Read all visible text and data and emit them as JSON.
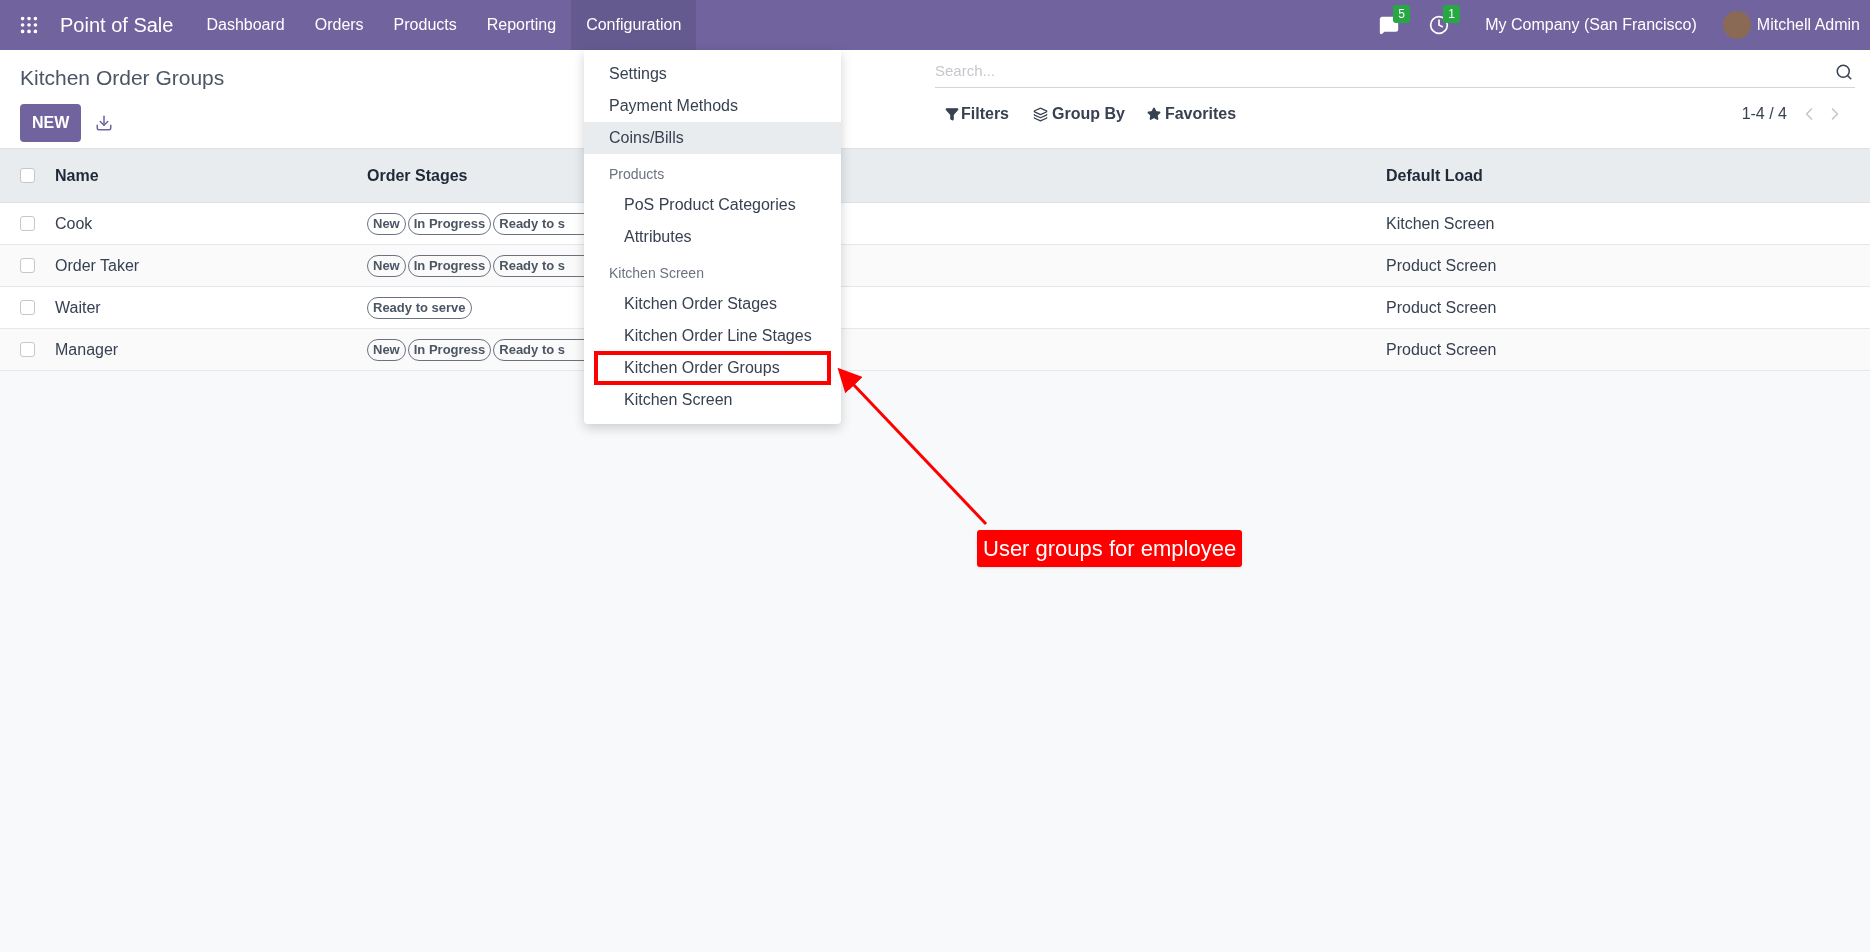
{
  "navbar": {
    "app_title": "Point of Sale",
    "menu": [
      {
        "label": "Dashboard",
        "selected": false
      },
      {
        "label": "Orders",
        "selected": false
      },
      {
        "label": "Products",
        "selected": false
      },
      {
        "label": "Reporting",
        "selected": false
      },
      {
        "label": "Configuration",
        "selected": true
      }
    ],
    "messages_count": "5",
    "activities_count": "1",
    "company": "My Company (San Francisco)",
    "user": "Mitchell Admin"
  },
  "control_panel": {
    "title": "Kitchen Order Groups",
    "new_button": "NEW",
    "search": {
      "placeholder": "Search..."
    },
    "filters": "Filters",
    "group_by": "Group By",
    "favorites": "Favorites",
    "pager": "1-4 / 4"
  },
  "table": {
    "select_all_checked": false,
    "columns": [
      "Name",
      "Order Stages",
      "Default Load"
    ],
    "rows": [
      {
        "name": "Cook",
        "stages": [
          {
            "label": "New",
            "truncated": false
          },
          {
            "label": "In Progress",
            "truncated": false
          },
          {
            "label": "Ready to s",
            "truncated": true
          }
        ],
        "default_load": "Kitchen Screen",
        "checked": false
      },
      {
        "name": "Order Taker",
        "stages": [
          {
            "label": "New",
            "truncated": false
          },
          {
            "label": "In Progress",
            "truncated": false
          },
          {
            "label": "Ready to s",
            "truncated": true
          }
        ],
        "default_load": "Product Screen",
        "checked": false
      },
      {
        "name": "Waiter",
        "stages": [
          {
            "label": "Ready to serve",
            "truncated": false
          }
        ],
        "default_load": "Product Screen",
        "checked": false
      },
      {
        "name": "Manager",
        "stages": [
          {
            "label": "New",
            "truncated": false
          },
          {
            "label": "In Progress",
            "truncated": false
          },
          {
            "label": "Ready to s",
            "truncated": true
          }
        ],
        "default_load": "Product Screen",
        "checked": false
      }
    ]
  },
  "dropdown": {
    "items": [
      {
        "kind": "item",
        "label": "Settings",
        "selected": false,
        "highlighted": false
      },
      {
        "kind": "item",
        "label": "Payment Methods",
        "selected": false,
        "highlighted": false
      },
      {
        "kind": "item",
        "label": "Coins/Bills",
        "selected": true,
        "highlighted": false
      },
      {
        "kind": "header",
        "label": "Products"
      },
      {
        "kind": "subitem",
        "label": "PoS Product Categories",
        "selected": false,
        "highlighted": false
      },
      {
        "kind": "subitem",
        "label": "Attributes",
        "selected": false,
        "highlighted": false
      },
      {
        "kind": "header",
        "label": "Kitchen Screen"
      },
      {
        "kind": "subitem",
        "label": "Kitchen Order Stages",
        "selected": false,
        "highlighted": false
      },
      {
        "kind": "subitem",
        "label": "Kitchen Order Line Stages",
        "selected": false,
        "highlighted": false
      },
      {
        "kind": "subitem",
        "label": "Kitchen Order Groups",
        "selected": false,
        "highlighted": true
      },
      {
        "kind": "subitem",
        "label": "Kitchen Screen",
        "selected": false,
        "highlighted": false
      }
    ]
  },
  "annotation": {
    "text": "User groups for employee"
  }
}
